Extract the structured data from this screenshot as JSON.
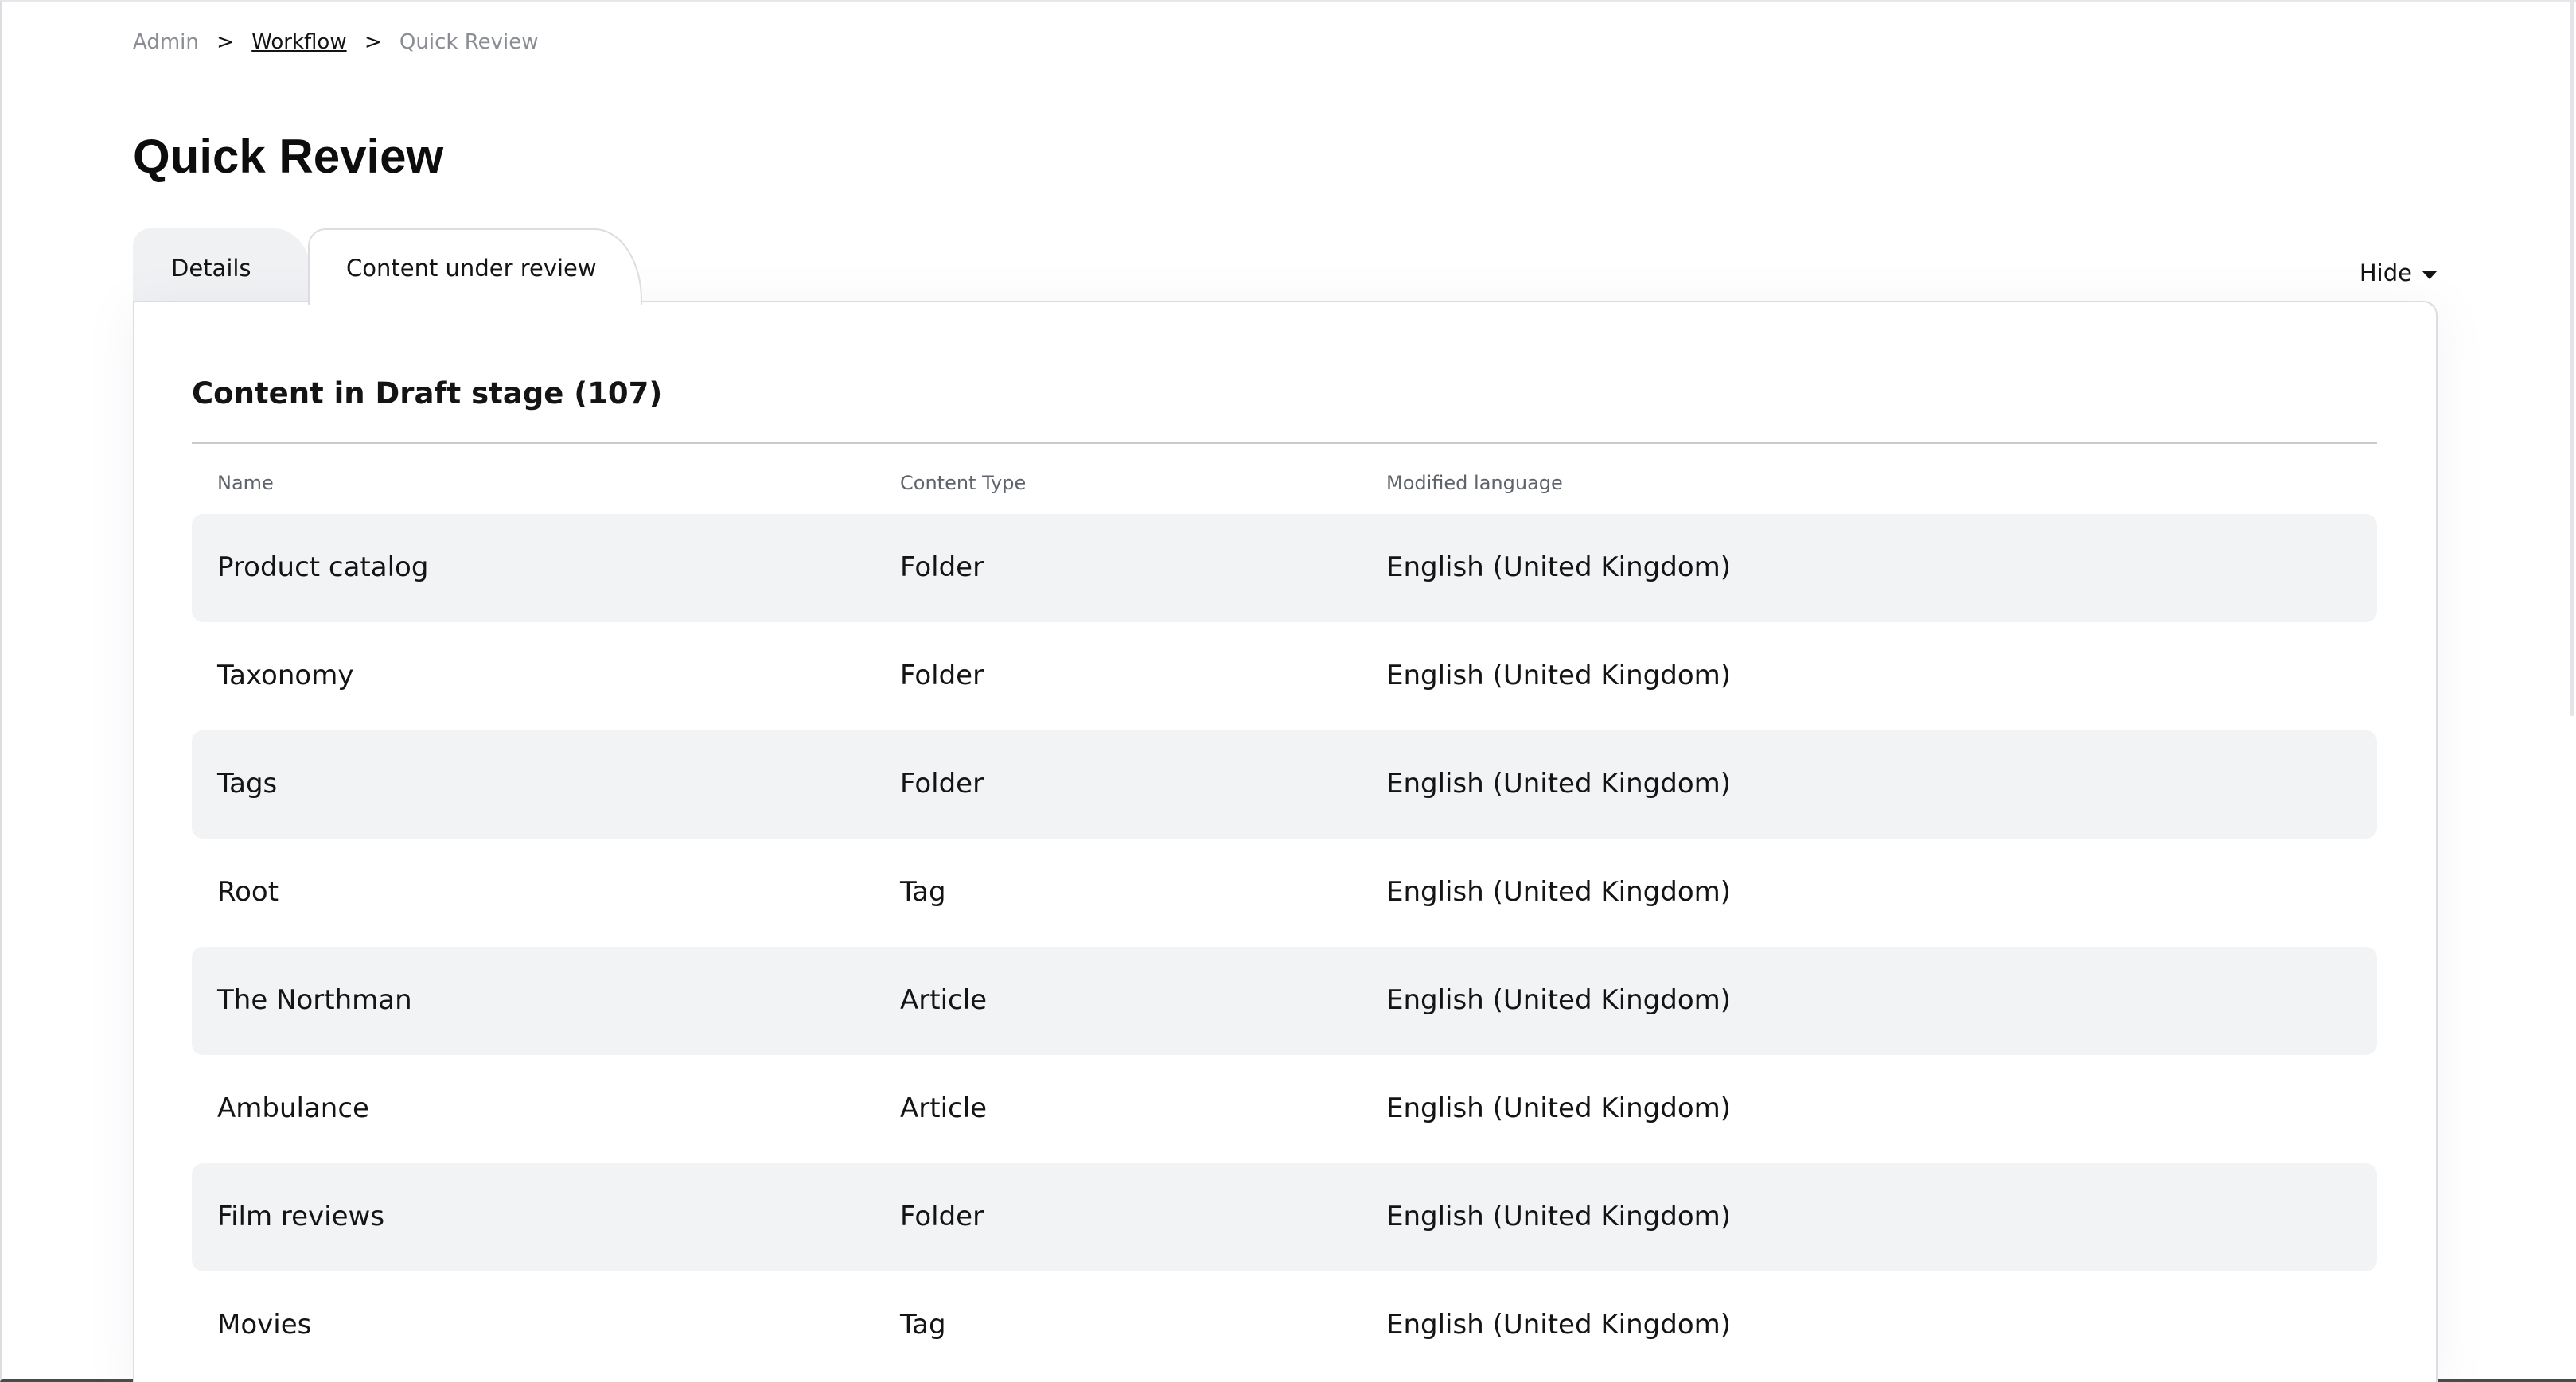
{
  "breadcrumb": {
    "items": [
      "Admin",
      "Workflow",
      "Quick Review"
    ],
    "separator": ">"
  },
  "page": {
    "title": "Quick Review"
  },
  "tabs": [
    {
      "label": "Details",
      "active": false
    },
    {
      "label": "Content under review",
      "active": true
    }
  ],
  "toggle": {
    "label": "Hide",
    "icon": "caret-down-icon"
  },
  "section": {
    "title": "Content in Draft stage (107)"
  },
  "table": {
    "columns": [
      "Name",
      "Content Type",
      "Modified language"
    ],
    "rows": [
      {
        "name": "Product catalog",
        "type": "Folder",
        "language": "English (United Kingdom)"
      },
      {
        "name": "Taxonomy",
        "type": "Folder",
        "language": "English (United Kingdom)"
      },
      {
        "name": "Tags",
        "type": "Folder",
        "language": "English (United Kingdom)"
      },
      {
        "name": "Root",
        "type": "Tag",
        "language": "English (United Kingdom)"
      },
      {
        "name": "The Northman",
        "type": "Article",
        "language": "English (United Kingdom)"
      },
      {
        "name": "Ambulance",
        "type": "Article",
        "language": "English (United Kingdom)"
      },
      {
        "name": "Film reviews",
        "type": "Folder",
        "language": "English (United Kingdom)"
      },
      {
        "name": "Movies",
        "type": "Tag",
        "language": "English (United Kingdom)"
      }
    ]
  },
  "colors": {
    "row_shade": "#f2f3f5",
    "border": "#dcdde1",
    "text": "#141414",
    "muted": "#8a8d93"
  }
}
